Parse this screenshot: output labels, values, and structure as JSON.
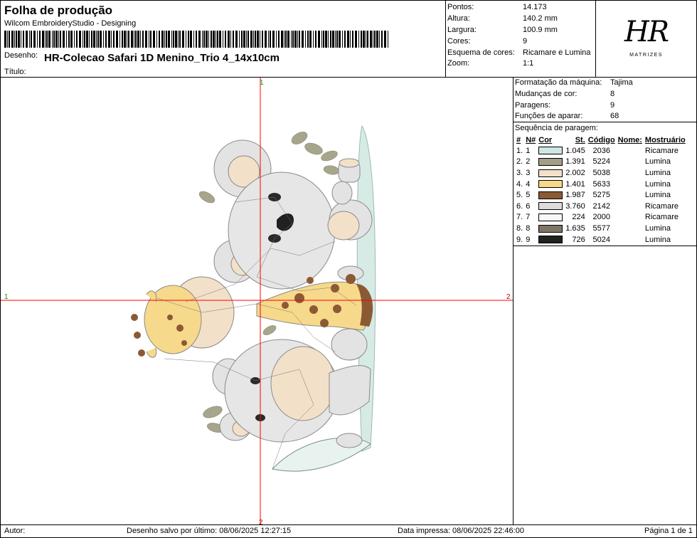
{
  "header": {
    "title": "Folha de produção",
    "software": "Wilcom EmbroideryStudio - Designing",
    "design_label": "Desenho:",
    "design_name": "HR-Colecao Safari 1D Menino_Trio 4_14x10cm",
    "title_label": "Título:"
  },
  "stats": [
    {
      "key": "Pontos:",
      "value": "14.173"
    },
    {
      "key": "Altura:",
      "value": "140.2 mm"
    },
    {
      "key": "Largura:",
      "value": "100.9 mm"
    },
    {
      "key": "Cores:",
      "value": "9"
    },
    {
      "key": "Esquema de cores:",
      "value": "Ricamare e Lumina"
    },
    {
      "key": "Zoom:",
      "value": "1:1"
    }
  ],
  "logo": {
    "mark": "HR",
    "sub": "MATRIZES"
  },
  "machine": [
    {
      "key": "Formatação da máquina:",
      "value": "Tajima"
    },
    {
      "key": "Mudanças de cor:",
      "value": "8"
    },
    {
      "key": "Paragens:",
      "value": "9"
    },
    {
      "key": "Funções de aparar:",
      "value": "68"
    }
  ],
  "sequence": {
    "title": "Sequência de paragem:",
    "headers": [
      "#",
      "N#",
      "Cor",
      "St.",
      "Código",
      "Nome:",
      "Mostruário"
    ],
    "rows": [
      {
        "idx": "1.",
        "n": "1",
        "color": "#cfe7e2",
        "st": "1.045",
        "code": "2036",
        "name": "",
        "chart": "Ricamare"
      },
      {
        "idx": "2.",
        "n": "2",
        "color": "#a29f87",
        "st": "1.391",
        "code": "5224",
        "name": "",
        "chart": "Lumina"
      },
      {
        "idx": "3.",
        "n": "3",
        "color": "#f3e0c9",
        "st": "2.002",
        "code": "5038",
        "name": "",
        "chart": "Lumina"
      },
      {
        "idx": "4.",
        "n": "4",
        "color": "#f6d98a",
        "st": "1.401",
        "code": "5633",
        "name": "",
        "chart": "Lumina"
      },
      {
        "idx": "5.",
        "n": "5",
        "color": "#8b5a35",
        "st": "1.987",
        "code": "5275",
        "name": "",
        "chart": "Lumina"
      },
      {
        "idx": "6.",
        "n": "6",
        "color": "#dcdcdc",
        "st": "3.760",
        "code": "2142",
        "name": "",
        "chart": "Ricamare"
      },
      {
        "idx": "7.",
        "n": "7",
        "color": "#f8f8f8",
        "st": "224",
        "code": "2000",
        "name": "",
        "chart": "Ricamare"
      },
      {
        "idx": "8.",
        "n": "8",
        "color": "#7d7565",
        "st": "1.635",
        "code": "5577",
        "name": "",
        "chart": "Lumina"
      },
      {
        "idx": "9.",
        "n": "9",
        "color": "#1f221f",
        "st": "726",
        "code": "5024",
        "name": "",
        "chart": "Lumina"
      }
    ]
  },
  "crosshair": {
    "top": "1",
    "bottom": "2",
    "left": "1",
    "right": "2"
  },
  "footer": {
    "author_label": "Autor:",
    "saved": "Desenho salvo por último: 08/06/2025 12:27:15",
    "printed": "Data impressa: 08/06/2025 22:46:00",
    "page": "Página 1 de 1"
  }
}
